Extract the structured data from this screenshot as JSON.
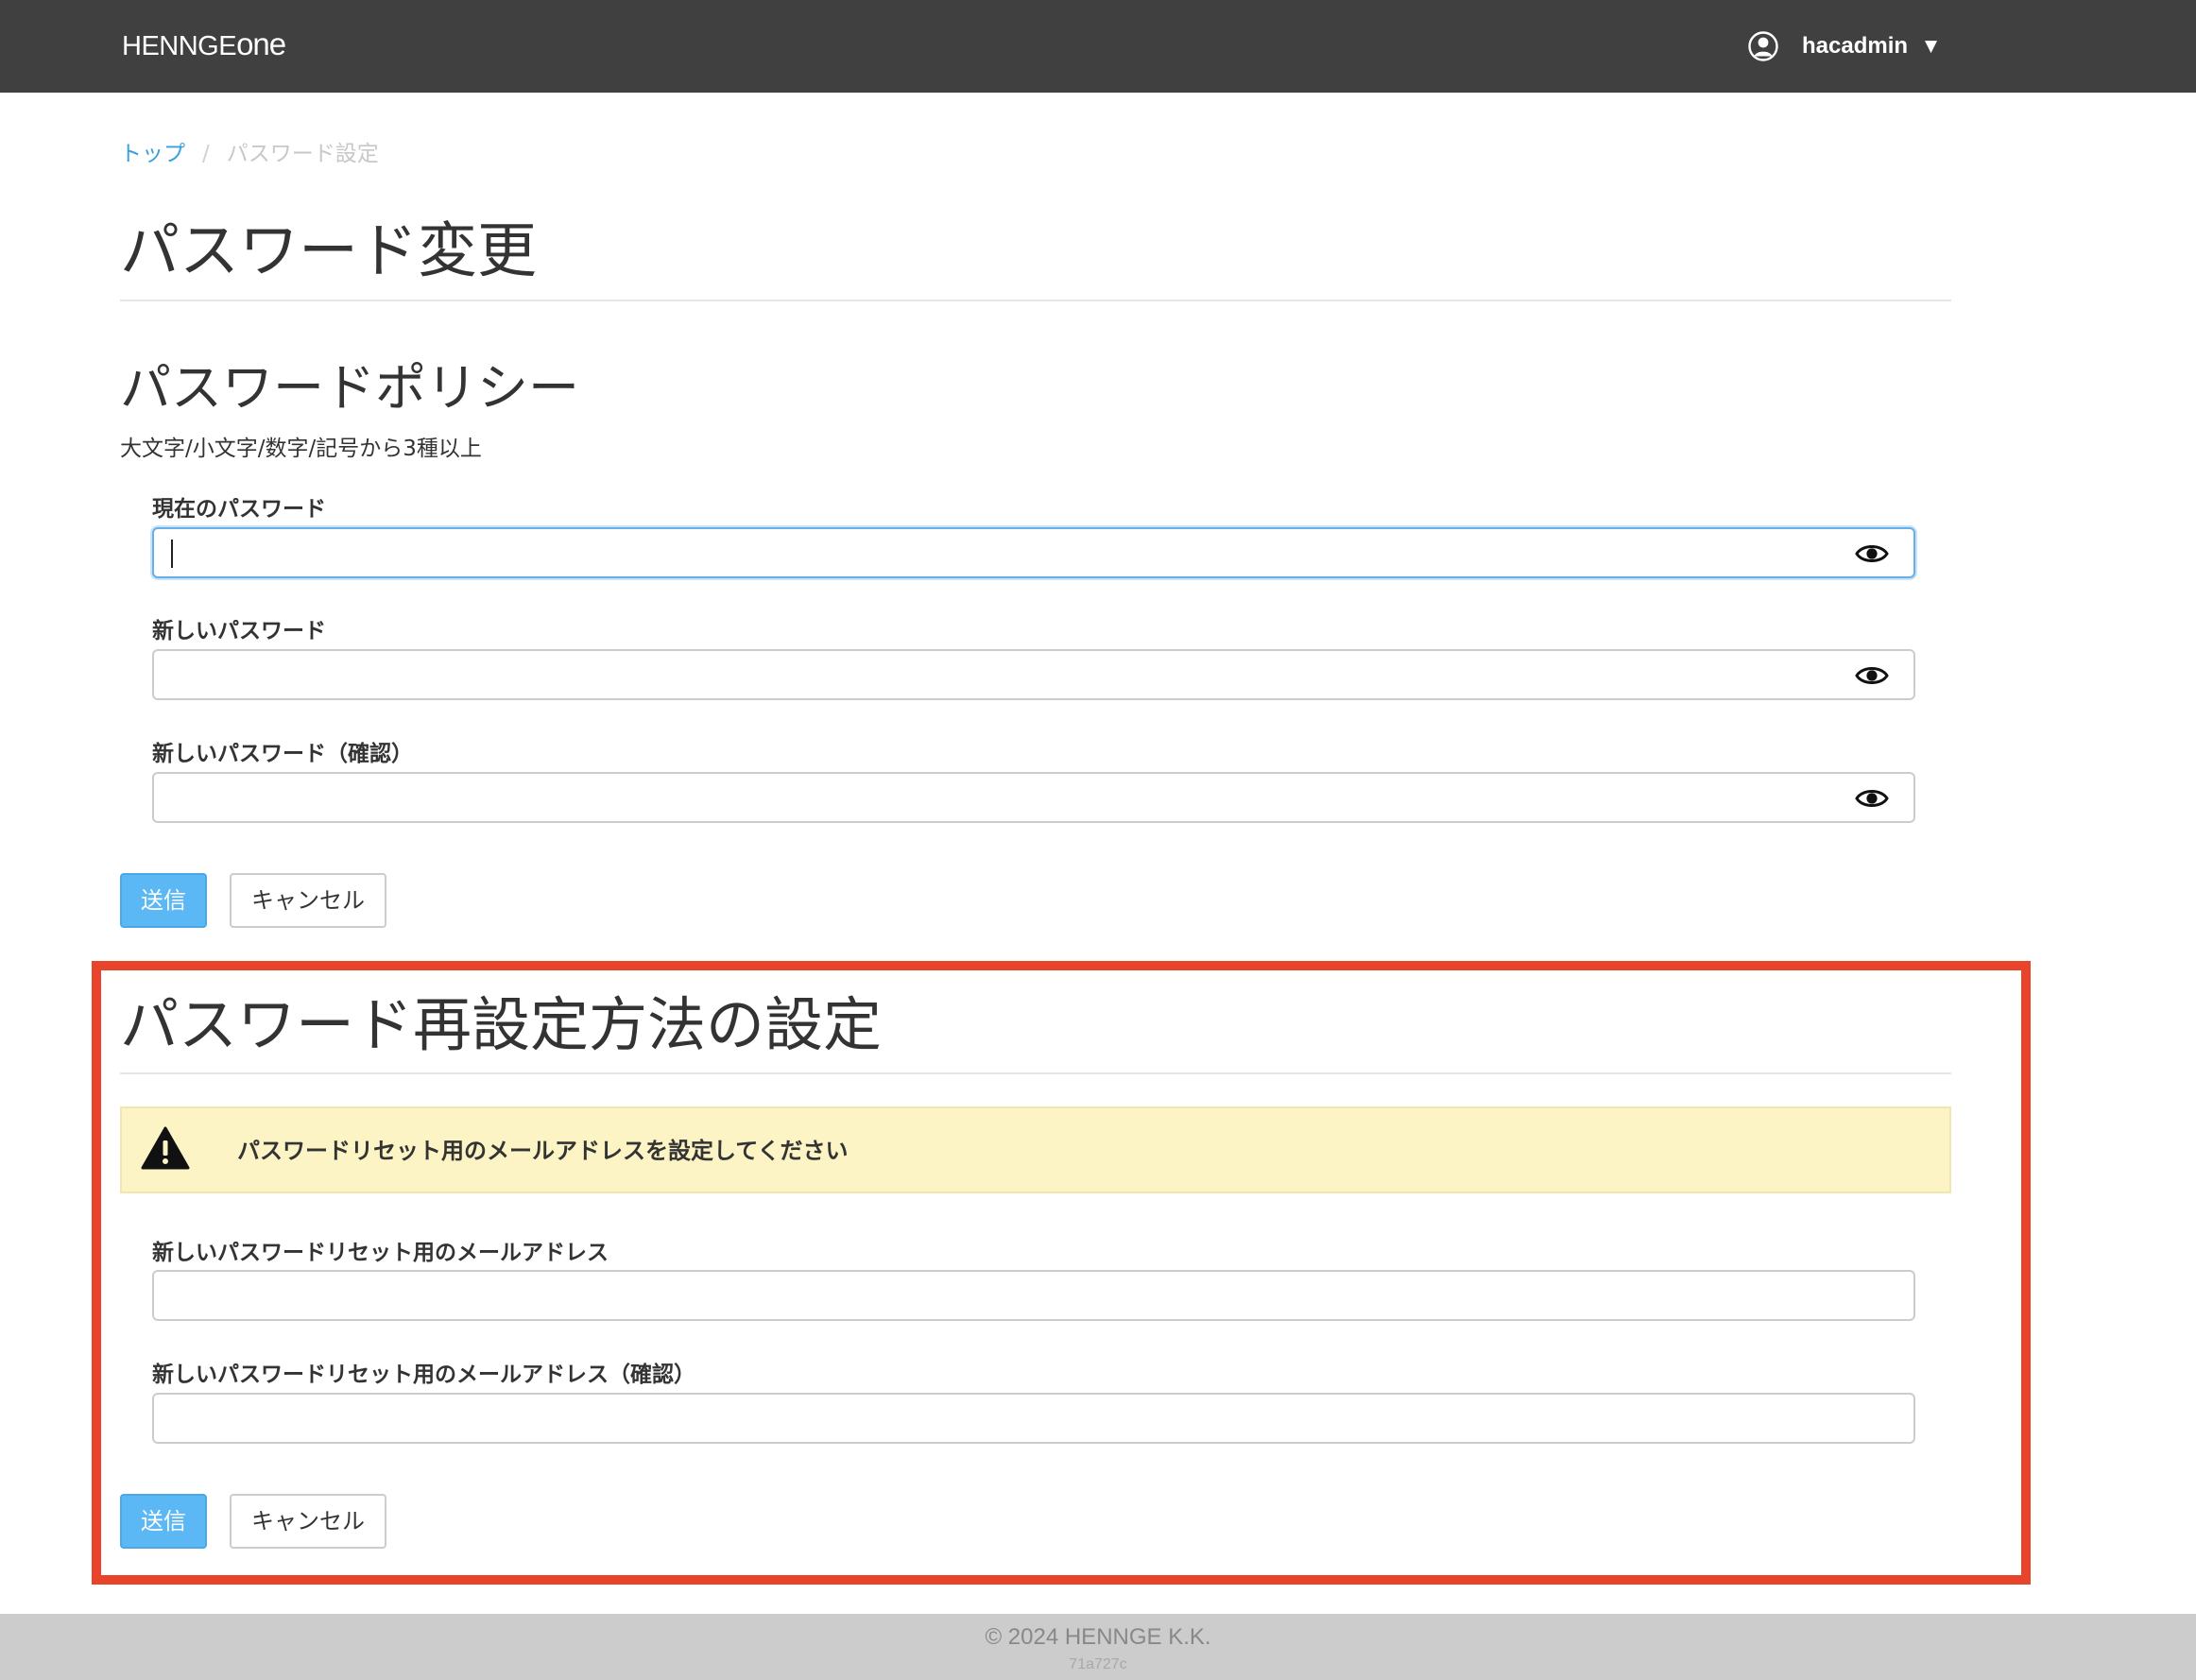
{
  "header": {
    "brand": "HENNGE",
    "brand_suffix": "one",
    "username": "hacadmin",
    "caret": "▼",
    "avatar_icon": "user-circle-icon",
    "background": "#404040"
  },
  "breadcrumb": {
    "home": "トップ",
    "separator": "/",
    "current": "パスワード設定"
  },
  "password_change": {
    "title": "パスワード変更",
    "policy_heading": "パスワードポリシー",
    "policy_text": "大文字/小文字/数字/記号から3種以上",
    "fields": {
      "current": {
        "label": "現在のパスワード",
        "value": ""
      },
      "new": {
        "label": "新しいパスワード",
        "value": ""
      },
      "confirm": {
        "label": "新しいパスワード（確認）",
        "value": ""
      }
    },
    "toggle_icon": "eye-icon",
    "submit_label": "送信",
    "cancel_label": "キャンセル"
  },
  "reset_method": {
    "title": "パスワード再設定方法の設定",
    "alert": {
      "icon": "warning-icon",
      "text": "パスワードリセット用のメールアドレスを設定してください",
      "background": "#fcf4c5"
    },
    "fields": {
      "email": {
        "label": "新しいパスワードリセット用のメールアドレス",
        "value": ""
      },
      "email_confirm": {
        "label": "新しいパスワードリセット用のメールアドレス（確認）",
        "value": ""
      }
    },
    "submit_label": "送信",
    "cancel_label": "キャンセル"
  },
  "colors": {
    "primary_button": "#5bb8f5",
    "link": "#3aa0dc",
    "highlight_frame": "#e8442c"
  },
  "footer": {
    "copyright": "© 2024 HENNGE K.K.",
    "build": "71a727c"
  }
}
